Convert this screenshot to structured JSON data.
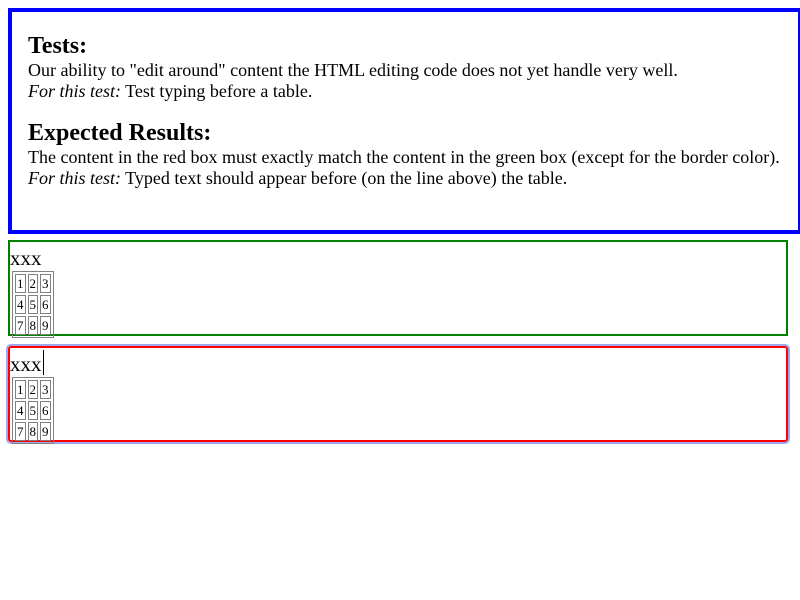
{
  "explanation": {
    "tests_heading": "Tests:",
    "tests_text": "Our ability to \"edit around\" content the HTML editing code does not yet handle very well.",
    "for_this_test_label": "For this test:",
    "tests_detail": " Test typing before a table.",
    "expected_heading": "Expected Results:",
    "expected_text": "The content in the red box must exactly match the content in the green box (except for the border color).",
    "expected_detail": " Typed text should appear before (on the line above) the table."
  },
  "expected_box": {
    "typed_text": "xxx",
    "table": [
      [
        "1",
        "2",
        "3"
      ],
      [
        "4",
        "5",
        "6"
      ],
      [
        "7",
        "8",
        "9"
      ]
    ]
  },
  "test_box": {
    "typed_text": "xxx",
    "table": [
      [
        "1",
        "2",
        "3"
      ],
      [
        "4",
        "5",
        "6"
      ],
      [
        "7",
        "8",
        "9"
      ]
    ]
  },
  "colors": {
    "explanation_border": "#0000ff",
    "expected_border": "#008000",
    "test_border": "#ff0000"
  }
}
